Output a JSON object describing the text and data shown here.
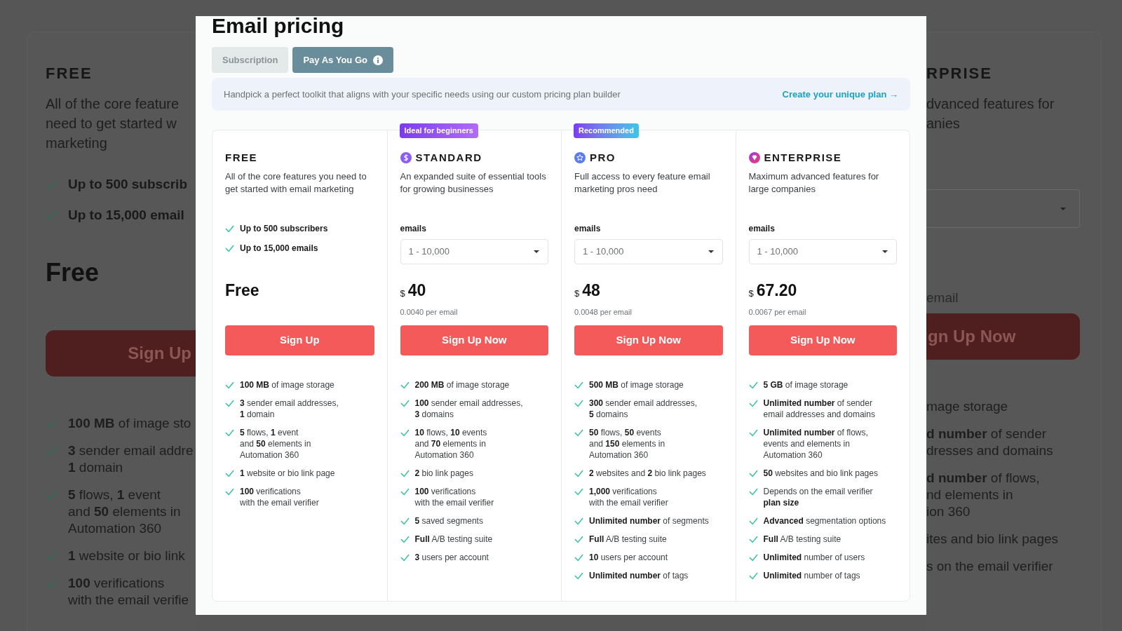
{
  "background": {
    "left": {
      "plan": "FREE",
      "description_lines": [
        "All of the core feature",
        "need to get started w",
        "marketing"
      ],
      "highlights": [
        "Up to 500 subscrib",
        "Up to 15,000 email"
      ],
      "price": "Free",
      "button": "Sign Up",
      "features": [
        {
          "lines": [
            "**100 MB** of image sto"
          ]
        },
        {
          "lines": [
            "**3** sender email addre",
            "**1** domain"
          ]
        },
        {
          "lines": [
            "**5** flows, **1** event",
            "and **50** elements in",
            "Automation 360"
          ]
        },
        {
          "lines": [
            "**1** website or bio link"
          ]
        },
        {
          "lines": [
            "**100** verifications",
            "with the email verifie"
          ]
        }
      ]
    },
    "right": {
      "plan": "RPRISE",
      "description_lines": [
        "dvanced features for",
        "anies"
      ],
      "per_email": "email",
      "button": "gn Up Now",
      "features": [
        {
          "lines": [
            "mage storage"
          ]
        },
        {
          "lines": [
            "**d number** of sender",
            "dresses and domains"
          ]
        },
        {
          "lines": [
            "**d number** of flows,",
            "nd elements in",
            "ion 360"
          ]
        },
        {
          "lines": [
            "ites and bio link pages"
          ]
        },
        {
          "lines": [
            "s on the email verifier"
          ]
        }
      ]
    }
  },
  "modal": {
    "title": "Email pricing",
    "tabs": [
      {
        "label": "Subscription",
        "selected": false
      },
      {
        "label": "Pay As You Go",
        "selected": true
      }
    ],
    "banner": {
      "text": "Handpick a perfect toolkit that aligns with your specific needs using our custom pricing plan builder",
      "link": "Create your unique plan →"
    },
    "plans": [
      {
        "kind": "free",
        "name": "FREE",
        "description": "All of the core features you need to get started with email marketing",
        "highlights": [
          "Up to 500 subscribers",
          "Up to 15,000 emails"
        ],
        "price": {
          "amount": "Free"
        },
        "button": "Sign Up",
        "features": [
          {
            "lines": [
              "**100 MB** of image storage"
            ]
          },
          {
            "lines": [
              "**3** sender email addresses,",
              "**1** domain"
            ]
          },
          {
            "lines": [
              "**5** flows, **1** event",
              "and **50** elements in",
              "Automation 360"
            ]
          },
          {
            "lines": [
              "**1** website or bio link page"
            ]
          },
          {
            "lines": [
              "**100** verifications",
              "with the email verifier"
            ]
          }
        ]
      },
      {
        "kind": "standard",
        "badge": "Ideal for beginners",
        "name": "STANDARD",
        "description": "An expanded suite of essential tools for growing businesses",
        "selector": {
          "label": "emails",
          "value": "1 - 10,000"
        },
        "price": {
          "currency": "$",
          "amount": "40"
        },
        "per_email": "0.0040 per email",
        "button": "Sign Up Now",
        "features": [
          {
            "lines": [
              "**200 MB** of image storage"
            ]
          },
          {
            "lines": [
              "**100** sender email addresses,",
              "**3** domains"
            ]
          },
          {
            "lines": [
              "**10** flows, **10** events",
              "and **70** elements in",
              "Automation 360"
            ]
          },
          {
            "lines": [
              "**2** bio link pages"
            ]
          },
          {
            "lines": [
              "**100** verifications",
              "with the email verifier"
            ]
          },
          {
            "lines": [
              "**5** saved segments"
            ]
          },
          {
            "lines": [
              "**Full** A/B testing suite"
            ]
          },
          {
            "lines": [
              "**3** users per account"
            ]
          }
        ]
      },
      {
        "kind": "pro",
        "badge": "Recommended",
        "name": "PRO",
        "description": "Full access to every feature email marketing pros need",
        "selector": {
          "label": "emails",
          "value": "1 - 10,000"
        },
        "price": {
          "currency": "$",
          "amount": "48"
        },
        "per_email": "0.0048 per email",
        "button": "Sign Up Now",
        "features": [
          {
            "lines": [
              "**500 MB** of image storage"
            ]
          },
          {
            "lines": [
              "**300** sender email addresses,",
              "**5** domains"
            ]
          },
          {
            "lines": [
              "**50** flows, **50** events",
              "and **150** elements in",
              "Automation 360"
            ]
          },
          {
            "lines": [
              "**2** websites and **2** bio link pages"
            ]
          },
          {
            "lines": [
              "**1,000** verifications",
              "with the email verifier"
            ]
          },
          {
            "lines": [
              "**Unlimited number** of segments"
            ]
          },
          {
            "lines": [
              "**Full** A/B testing suite"
            ]
          },
          {
            "lines": [
              "**10** users per account"
            ]
          },
          {
            "lines": [
              "**Unlimited number** of tags"
            ]
          }
        ]
      },
      {
        "kind": "enterprise",
        "name": "ENTERPRISE",
        "description": "Maximum advanced features for large companies",
        "selector": {
          "label": "emails",
          "value": "1 - 10,000"
        },
        "price": {
          "currency": "$",
          "amount": "67.20"
        },
        "per_email": "0.0067 per email",
        "button": "Sign Up Now",
        "features": [
          {
            "lines": [
              "**5 GB** of image storage"
            ]
          },
          {
            "lines": [
              "**Unlimited number** of sender",
              "email addresses and domains"
            ]
          },
          {
            "lines": [
              "**Unlimited number** of flows,",
              "events and elements in",
              "Automation 360"
            ]
          },
          {
            "lines": [
              "**50** websites and bio link pages"
            ]
          },
          {
            "lines": [
              "Depends on the email verifier",
              "**plan size**"
            ]
          },
          {
            "lines": [
              "**Advanced** segmentation options"
            ]
          },
          {
            "lines": [
              "**Full** A/B testing suite"
            ]
          },
          {
            "lines": [
              "**Unlimited** number of users"
            ]
          },
          {
            "lines": [
              "**Unlimited** number of tags"
            ]
          }
        ]
      }
    ]
  }
}
